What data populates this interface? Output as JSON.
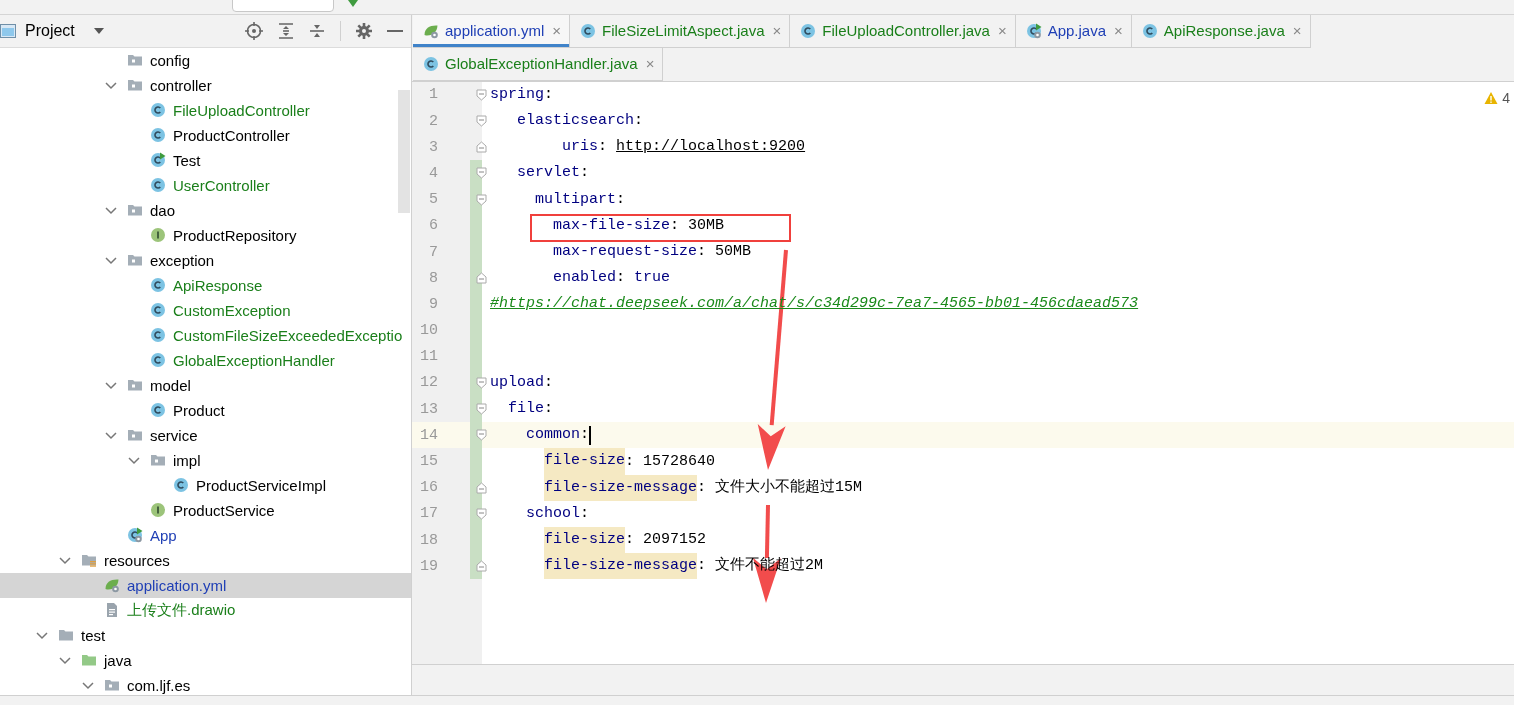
{
  "project_panel": {
    "title": "Project",
    "tree": [
      {
        "children": [
          {
            "children": [
              {
                "children": [
                  {
                    "label": "config",
                    "kind": "package",
                    "color": "#000000",
                    "selected": false
                  },
                  {
                    "label": "controller",
                    "kind": "package",
                    "color": "#000000",
                    "selected": false,
                    "expanded": true,
                    "children": [
                      {
                        "label": "FileUploadController",
                        "kind": "class",
                        "color": "#1a7f1a",
                        "selected": false
                      },
                      {
                        "label": "ProductController",
                        "kind": "class",
                        "color": "#000000",
                        "selected": false
                      },
                      {
                        "label": "Test",
                        "kind": "runnable-class",
                        "color": "#000000",
                        "selected": false
                      },
                      {
                        "label": "UserController",
                        "kind": "class",
                        "color": "#1a7f1a",
                        "selected": false
                      }
                    ]
                  },
                  {
                    "label": "dao",
                    "kind": "package",
                    "color": "#000000",
                    "selected": false,
                    "expanded": true,
                    "children": [
                      {
                        "label": "ProductRepository",
                        "kind": "interface",
                        "color": "#000000",
                        "selected": false
                      }
                    ]
                  },
                  {
                    "label": "exception",
                    "kind": "package",
                    "color": "#000000",
                    "selected": false,
                    "expanded": true,
                    "children": [
                      {
                        "label": "ApiResponse",
                        "kind": "class",
                        "color": "#1a7f1a",
                        "selected": false
                      },
                      {
                        "label": "CustomException",
                        "kind": "class",
                        "color": "#1a7f1a",
                        "selected": false
                      },
                      {
                        "label": "CustomFileSizeExceededExceptio",
                        "kind": "class",
                        "color": "#1a7f1a",
                        "selected": false
                      },
                      {
                        "label": "GlobalExceptionHandler",
                        "kind": "class",
                        "color": "#1a7f1a",
                        "selected": false
                      }
                    ]
                  },
                  {
                    "label": "model",
                    "kind": "package",
                    "color": "#000000",
                    "selected": false,
                    "expanded": true,
                    "children": [
                      {
                        "label": "Product",
                        "kind": "class",
                        "color": "#000000",
                        "selected": false
                      }
                    ]
                  },
                  {
                    "label": "service",
                    "kind": "package",
                    "color": "#000000",
                    "selected": false,
                    "expanded": true,
                    "children": [
                      {
                        "label": "impl",
                        "kind": "package",
                        "color": "#000000",
                        "selected": false,
                        "expanded": true,
                        "children": [
                          {
                            "label": "ProductServiceImpl",
                            "kind": "class",
                            "color": "#000000",
                            "selected": false
                          }
                        ]
                      },
                      {
                        "label": "ProductService",
                        "kind": "interface",
                        "color": "#000000",
                        "selected": false
                      }
                    ]
                  },
                  {
                    "label": "App",
                    "kind": "app-class",
                    "color": "#1f3fb5",
                    "selected": false
                  }
                ]
              }
            ]
          },
          {
            "label": "resources",
            "kind": "resources-root",
            "color": "#000000",
            "selected": false,
            "expanded": true,
            "children": [
              {
                "label": "application.yml",
                "kind": "spring-config",
                "color": "#1f3fb5",
                "selected": true
              },
              {
                "label": "上传文件.drawio",
                "kind": "text-file",
                "color": "#1a7f1a",
                "selected": false
              }
            ]
          }
        ]
      },
      {
        "label": "test",
        "kind": "folder",
        "color": "#000000",
        "selected": false,
        "expanded": true,
        "children": [
          {
            "label": "java",
            "kind": "test-root",
            "color": "#000000",
            "selected": false,
            "expanded": true,
            "children": [
              {
                "label": "com.ljf.es",
                "kind": "package",
                "color": "#000000",
                "selected": false,
                "expanded": true
              }
            ]
          }
        ]
      }
    ]
  },
  "tabs": [
    {
      "label": "application.yml",
      "kind": "spring-config",
      "color": "#1f3fb5",
      "selected": true,
      "close": "×"
    },
    {
      "label": "FileSizeLimitAspect.java",
      "kind": "class",
      "color": "#1a7f1a",
      "selected": false,
      "close": "×"
    },
    {
      "label": "FileUploadController.java",
      "kind": "class",
      "color": "#1a7f1a",
      "selected": false,
      "close": "×"
    },
    {
      "label": "App.java",
      "kind": "app-class",
      "color": "#1f3fb5",
      "selected": false,
      "close": "×"
    },
    {
      "label": "ApiResponse.java",
      "kind": "class",
      "color": "#1a7f1a",
      "selected": false,
      "close": "×"
    },
    {
      "label": "GlobalExceptionHandler.java",
      "kind": "class",
      "color": "#1a7f1a",
      "selected": false,
      "close": "×"
    }
  ],
  "editor": {
    "warning_count": "4",
    "lines": [
      {
        "number": "1",
        "fold_start": true,
        "fold_end": false,
        "changed": false,
        "current": false,
        "segments": [
          {
            "kind": "key",
            "text": "spring"
          },
          {
            "kind": "punct",
            "text": ":"
          }
        ]
      },
      {
        "number": "2",
        "fold_start": true,
        "fold_end": false,
        "changed": false,
        "current": false,
        "segments": [
          {
            "kind": "key",
            "text": "   elasticsearch"
          },
          {
            "kind": "punct",
            "text": ":"
          }
        ]
      },
      {
        "number": "3",
        "fold_start": false,
        "fold_end": true,
        "changed": false,
        "current": false,
        "segments": [
          {
            "kind": "key",
            "text": "        uris"
          },
          {
            "kind": "punct",
            "text": ": "
          },
          {
            "kind": "url",
            "text": "http://localhost:9200"
          }
        ]
      },
      {
        "number": "4",
        "fold_start": true,
        "fold_end": false,
        "changed": true,
        "current": false,
        "segments": [
          {
            "kind": "key",
            "text": "   servlet"
          },
          {
            "kind": "punct",
            "text": ":"
          }
        ]
      },
      {
        "number": "5",
        "fold_start": true,
        "fold_end": false,
        "changed": true,
        "current": false,
        "segments": [
          {
            "kind": "key",
            "text": "     multipart"
          },
          {
            "kind": "punct",
            "text": ":"
          }
        ]
      },
      {
        "number": "6",
        "fold_start": false,
        "fold_end": false,
        "changed": true,
        "current": false,
        "segments": [
          {
            "kind": "key",
            "text": "       max-file-size"
          },
          {
            "kind": "punct",
            "text": ": "
          },
          {
            "kind": "value",
            "text": "30MB"
          }
        ]
      },
      {
        "number": "7",
        "fold_start": false,
        "fold_end": false,
        "changed": true,
        "current": false,
        "segments": [
          {
            "kind": "key",
            "text": "       max-request-size"
          },
          {
            "kind": "punct",
            "text": ": "
          },
          {
            "kind": "value",
            "text": "50MB"
          }
        ]
      },
      {
        "number": "8",
        "fold_start": false,
        "fold_end": true,
        "changed": true,
        "current": false,
        "segments": [
          {
            "kind": "key",
            "text": "       enabled"
          },
          {
            "kind": "punct",
            "text": ": "
          },
          {
            "kind": "key",
            "text": "true"
          }
        ]
      },
      {
        "number": "9",
        "fold_start": false,
        "fold_end": false,
        "changed": true,
        "current": false,
        "segments": [
          {
            "kind": "comment",
            "text": "#https://chat.deepseek.com/a/chat/s/c34d299c-7ea7-4565-bb01-456cdaead573"
          }
        ]
      },
      {
        "number": "10",
        "fold_start": false,
        "fold_end": false,
        "changed": true,
        "current": false
      },
      {
        "number": "11",
        "fold_start": false,
        "fold_end": false,
        "changed": true,
        "current": false
      },
      {
        "number": "12",
        "fold_start": true,
        "fold_end": false,
        "changed": true,
        "current": false,
        "segments": [
          {
            "kind": "key",
            "text": "upload"
          },
          {
            "kind": "punct",
            "text": ":"
          }
        ]
      },
      {
        "number": "13",
        "fold_start": true,
        "fold_end": false,
        "changed": true,
        "current": false,
        "segments": [
          {
            "kind": "key",
            "text": "  file"
          },
          {
            "kind": "punct",
            "text": ":"
          }
        ]
      },
      {
        "number": "14",
        "fold_start": true,
        "fold_end": false,
        "changed": true,
        "current": true,
        "segments": [
          {
            "kind": "key",
            "text": "    common"
          },
          {
            "kind": "punct",
            "text": ":"
          }
        ]
      },
      {
        "number": "15",
        "fold_start": false,
        "fold_end": false,
        "changed": true,
        "current": false,
        "segments": [
          {
            "kind": "key-match",
            "text": "      file-size"
          },
          {
            "kind": "punct",
            "text": ": "
          },
          {
            "kind": "value",
            "text": "15728640"
          }
        ]
      },
      {
        "number": "16",
        "fold_start": false,
        "fold_end": true,
        "changed": true,
        "current": false,
        "segments": [
          {
            "kind": "key-match",
            "text": "      file-size-message"
          },
          {
            "kind": "punct",
            "text": ": "
          },
          {
            "kind": "value",
            "text": "文件大小不能超过15M"
          }
        ]
      },
      {
        "number": "17",
        "fold_start": true,
        "fold_end": false,
        "changed": true,
        "current": false,
        "segments": [
          {
            "kind": "key",
            "text": "    school"
          },
          {
            "kind": "punct",
            "text": ":"
          }
        ]
      },
      {
        "number": "18",
        "fold_start": false,
        "fold_end": false,
        "changed": true,
        "current": false,
        "segments": [
          {
            "kind": "key-match",
            "text": "      file-size"
          },
          {
            "kind": "punct",
            "text": ": "
          },
          {
            "kind": "value",
            "text": "2097152"
          }
        ]
      },
      {
        "number": "19",
        "fold_start": false,
        "fold_end": true,
        "changed": true,
        "current": false,
        "segments": [
          {
            "kind": "key-match",
            "text": "      file-size-message"
          },
          {
            "kind": "punct",
            "text": ": "
          },
          {
            "kind": "value",
            "text": "文件不能超过2M"
          }
        ]
      }
    ],
    "annotations": [
      {
        "kind": "box"
      },
      {
        "kind": "arrow"
      },
      {
        "kind": "arrow"
      }
    ]
  }
}
